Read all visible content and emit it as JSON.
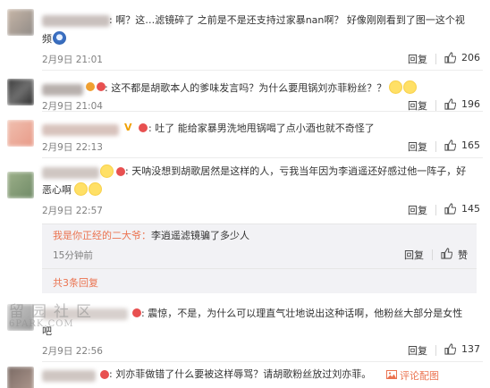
{
  "comments": [
    {
      "text_line1": ": 啊？这…滤镜碎了 之前是不是还支持过家暴nan啊？ 好像刚刚看到了图一这个视",
      "text_line2": "频",
      "time": "2月9日 21:01",
      "reply_label": "回复",
      "likes": "206"
    },
    {
      "text_line1": ": 这不都是胡歌本人的爹味发言吗？为什么要甩锅刘亦菲粉丝？？",
      "time": "2月9日 21:04",
      "reply_label": "回复",
      "likes": "196"
    },
    {
      "text_line1": ": 吐了 能给家暴男洗地甩锅喝了点小酒也就不奇怪了",
      "time": "2月9日 22:13",
      "reply_label": "回复",
      "likes": "165"
    },
    {
      "text_line1": ": 天呐没想到胡歌居然是这样的人，亏我当年因为李逍遥还好感过他一阵子，好",
      "text_line2": "恶心啊",
      "time": "2月9日 22:57",
      "reply_label": "回复",
      "likes": "145"
    },
    {
      "text_line1": ": 震惊，不是，为什么可以理直气壮地说出这种话啊，他粉丝大部分是女性",
      "text_line2": "吧",
      "time": "2月9日 22:56",
      "reply_label": "回复",
      "likes": "137"
    },
    {
      "text_line1": ": 刘亦菲做错了什么要被这样辱骂？请胡歌粉丝放过刘亦菲。",
      "comment_image_label": "评论配图"
    }
  ],
  "sub_reply": {
    "user": "我是你正经的二大爷",
    "separator": "：",
    "text": "李逍遥滤镜骗了多少人",
    "time": "15分钟前",
    "reply_label": "回复",
    "like_label": "赞",
    "more_label": "共3条回复"
  },
  "watermark": {
    "title": "留园社区",
    "site": "6PARK.COM"
  },
  "colors": {
    "link": "#eb7350",
    "meta": "#808080",
    "sub_bg": "#f2f2f5"
  },
  "icons": [
    "thumb-up-icon",
    "emoji-icon",
    "badge-icon",
    "vip-badge-icon",
    "image-icon"
  ]
}
